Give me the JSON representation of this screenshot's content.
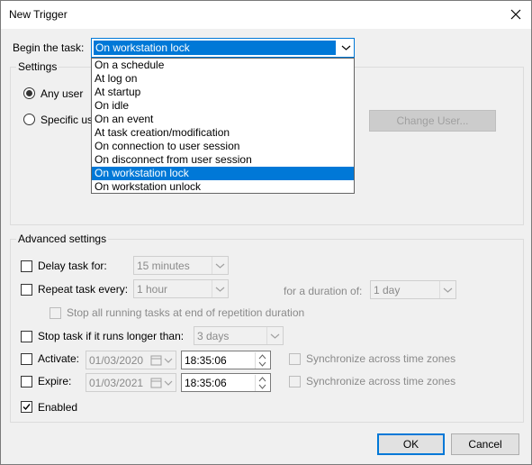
{
  "window": {
    "title": "New Trigger"
  },
  "begin": {
    "label": "Begin the task:",
    "selected": "On workstation lock",
    "options": [
      "On a schedule",
      "At log on",
      "At startup",
      "On idle",
      "On an event",
      "At task creation/modification",
      "On connection to user session",
      "On disconnect from user session",
      "On workstation lock",
      "On workstation unlock"
    ],
    "selected_index": 8
  },
  "settings": {
    "group_label": "Settings",
    "any_user": "Any user",
    "specific_user_partial": "Specific us",
    "change_user": "Change User..."
  },
  "advanced": {
    "group_label": "Advanced settings",
    "delay": {
      "label": "Delay task for:",
      "value": "15 minutes"
    },
    "repeat": {
      "label": "Repeat task every:",
      "value": "1 hour",
      "duration_label": "for a duration of:",
      "duration_value": "1 day"
    },
    "stop_all": "Stop all running tasks at end of repetition duration",
    "stop_longer": {
      "label": "Stop task if it runs longer than:",
      "value": "3 days"
    },
    "activate": {
      "label": "Activate:",
      "date": "01/03/2020",
      "time": "18:35:06",
      "sync": "Synchronize across time zones"
    },
    "expire": {
      "label": "Expire:",
      "date": "01/03/2021",
      "time": "18:35:06",
      "sync": "Synchronize across time zones"
    },
    "enabled": {
      "label": "Enabled",
      "checked": true
    }
  },
  "buttons": {
    "ok": "OK",
    "cancel": "Cancel"
  },
  "colors": {
    "accent": "#0078d7",
    "disabled_text": "#8a8a8a"
  }
}
